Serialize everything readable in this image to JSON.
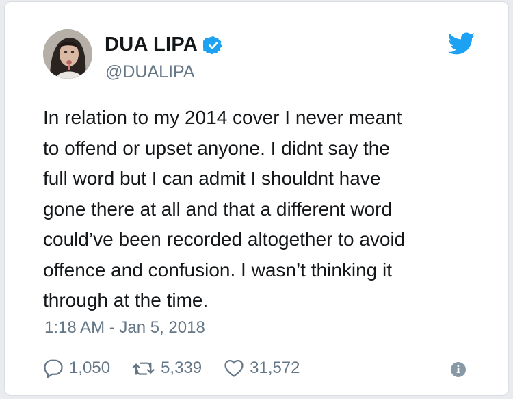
{
  "tweet": {
    "display_name": "DUA LIPA",
    "handle": "@DUALIPA",
    "verified": true,
    "text": "In relation to my 2014 cover I never meant\nto offend or upset anyone. I didnt say the\nfull word but I can admit I shouldnt have\ngone there at all and that a different word\ncould’ve been recorded altogether to avoid\noffence and confusion. I wasn’t thinking it\nthrough at the time.",
    "timestamp": "1:18 AM - Jan 5, 2018",
    "stats": {
      "replies": "1,050",
      "retweets": "5,339",
      "likes": "31,572"
    }
  },
  "icons": {
    "brand": "twitter-bird-icon",
    "verified": "verified-badge-icon",
    "reply": "reply-icon",
    "retweet": "retweet-icon",
    "like": "heart-icon",
    "info": "info-icon"
  },
  "colors": {
    "brand_blue": "#1da1f2",
    "text": "#14171a",
    "secondary_text": "#657786"
  }
}
